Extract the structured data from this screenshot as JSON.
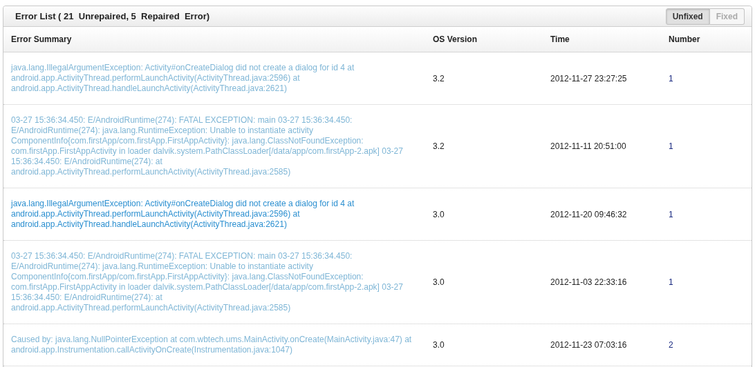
{
  "panel": {
    "title": "Error List ( 21  Unrepaired, 5  Repaired  Error)",
    "filters": [
      {
        "label": "Unfixed",
        "selected": true
      },
      {
        "label": "Fixed",
        "selected": false
      }
    ]
  },
  "table": {
    "columns": [
      "Error Summary",
      "OS Version",
      "Time",
      "Number"
    ],
    "rows": [
      {
        "summary": "java.lang.IllegalArgumentException: Activity#onCreateDialog did not create a dialog for id 4 at android.app.ActivityThread.performLaunchActivity(ActivityThread.java:2596) at android.app.ActivityThread.handleLaunchActivity(ActivityThread.java:2621)",
        "visited": true,
        "os_version": "3.2",
        "time": "2012-11-27 23:27:25",
        "number": "1"
      },
      {
        "summary": "03-27 15:36:34.450: E/AndroidRuntime(274): FATAL EXCEPTION: main 03-27 15:36:34.450: E/AndroidRuntime(274): java.lang.RuntimeException: Unable to instantiate activity ComponentInfo{com.firstApp/com.firstApp.FirstAppActivity}: java.lang.ClassNotFoundException: com.firstApp.FirstAppActivity in loader dalvik.system.PathClassLoader[/data/app/com.firstApp-2.apk] 03-27 15:36:34.450: E/AndroidRuntime(274): at android.app.ActivityThread.performLaunchActivity(ActivityThread.java:2585)",
        "visited": true,
        "os_version": "3.2",
        "time": "2012-11-11 20:51:00",
        "number": "1"
      },
      {
        "summary": "java.lang.IllegalArgumentException: Activity#onCreateDialog did not create a dialog for id 4 at android.app.ActivityThread.performLaunchActivity(ActivityThread.java:2596) at android.app.ActivityThread.handleLaunchActivity(ActivityThread.java:2621)",
        "visited": false,
        "os_version": "3.0",
        "time": "2012-11-20 09:46:32",
        "number": "1"
      },
      {
        "summary": "03-27 15:36:34.450: E/AndroidRuntime(274): FATAL EXCEPTION: main 03-27 15:36:34.450: E/AndroidRuntime(274): java.lang.RuntimeException: Unable to instantiate activity ComponentInfo{com.firstApp/com.firstApp.FirstAppActivity}: java.lang.ClassNotFoundException: com.firstApp.FirstAppActivity in loader dalvik.system.PathClassLoader[/data/app/com.firstApp-2.apk] 03-27 15:36:34.450: E/AndroidRuntime(274): at android.app.ActivityThread.performLaunchActivity(ActivityThread.java:2585)",
        "visited": true,
        "os_version": "3.0",
        "time": "2012-11-03 22:33:16",
        "number": "1"
      },
      {
        "summary": "Caused by: java.lang.NullPointerException at com.wbtech.ums.MainActivity.onCreate(MainActivity.java:47) at android.app.Instrumentation.callActivityOnCreate(Instrumentation.java:1047)",
        "visited": true,
        "os_version": "3.0",
        "time": "2012-11-23 07:03:16",
        "number": "2"
      }
    ]
  }
}
